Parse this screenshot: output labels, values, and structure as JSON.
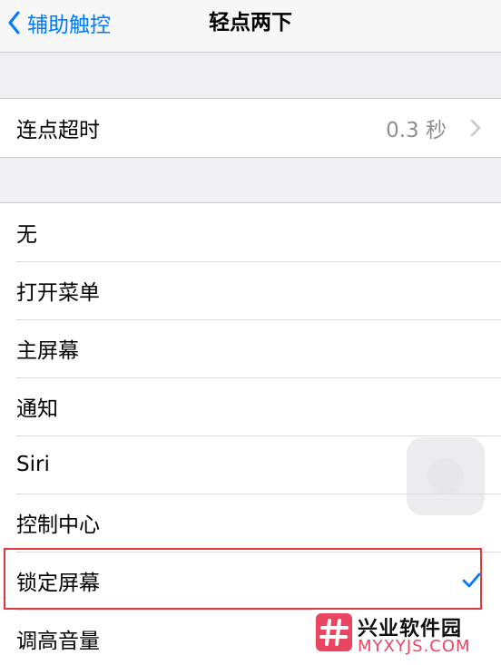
{
  "nav": {
    "back_label": "辅助触控",
    "title": "轻点两下"
  },
  "timeout_row": {
    "label": "连点超时",
    "value": "0.3 秒"
  },
  "options": [
    {
      "label": "无",
      "selected": false
    },
    {
      "label": "打开菜单",
      "selected": false
    },
    {
      "label": "主屏幕",
      "selected": false
    },
    {
      "label": "通知",
      "selected": false
    },
    {
      "label": "Siri",
      "selected": false
    },
    {
      "label": "控制中心",
      "selected": false
    },
    {
      "label": "锁定屏幕",
      "selected": true
    },
    {
      "label": "调高音量",
      "selected": false
    }
  ],
  "watermark": {
    "title": "兴业软件园",
    "url": "MYXYJS.COM"
  },
  "colors": {
    "accent": "#007aff",
    "highlight": "#e0393f",
    "watermark": "#e94560"
  }
}
